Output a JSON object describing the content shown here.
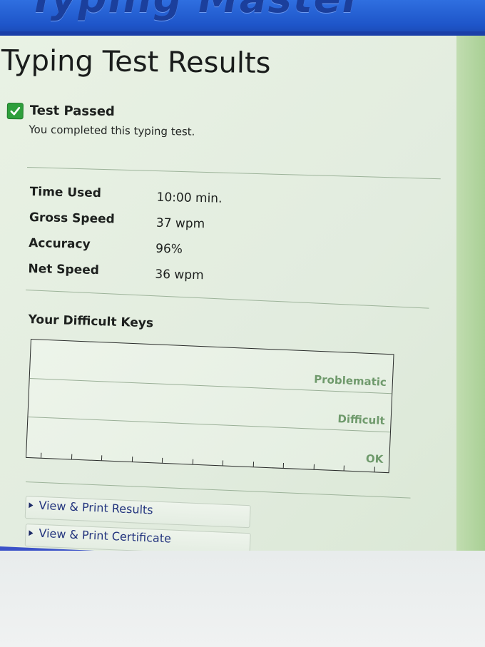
{
  "app": {
    "banner_logo": "Typing Master"
  },
  "page": {
    "title": "Typing Test Results"
  },
  "status": {
    "icon": "check-icon",
    "title": "Test Passed",
    "subtitle": "You completed this typing test."
  },
  "stats": [
    {
      "label": "Time Used",
      "value": "10:00 min."
    },
    {
      "label": "Gross Speed",
      "value": "37 wpm"
    },
    {
      "label": "Accuracy",
      "value": "96%"
    },
    {
      "label": "Net Speed",
      "value": "36 wpm"
    }
  ],
  "difficult_keys": {
    "title": "Your Difficult Keys",
    "levels": [
      "Problematic",
      "Difficult",
      "OK"
    ]
  },
  "actions": [
    {
      "label": "View & Print Results"
    },
    {
      "label": "View & Print Certificate"
    }
  ],
  "colors": {
    "banner": "#2f6fe0",
    "check": "#2e9f3c",
    "level_label": "#6f9a6c",
    "link": "#23347e"
  }
}
